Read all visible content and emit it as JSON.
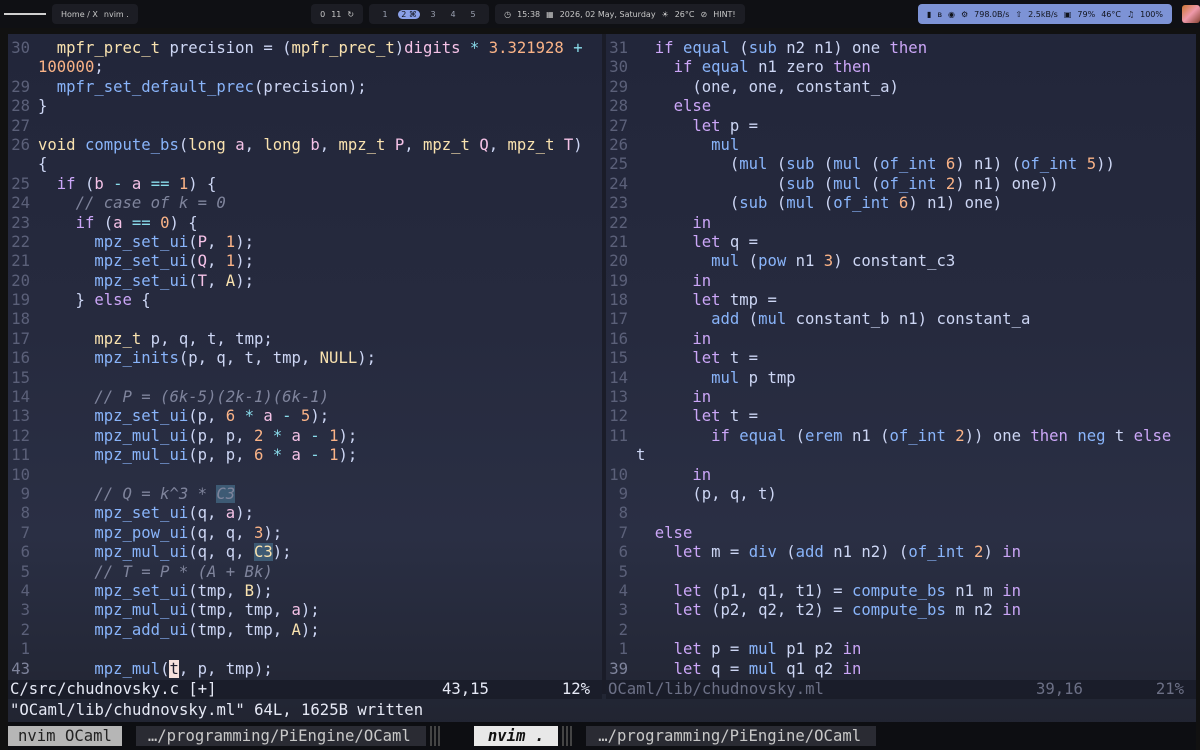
{
  "topbar": {
    "home_label": "Home / X",
    "nvim_label": "nvim .",
    "ws_icon": "0",
    "ws_count": "11",
    "workspaces": [
      "1",
      "2 ⌘",
      "3",
      "4",
      "5"
    ],
    "time": "15:38",
    "date": "2026, 02 May, Saturday",
    "temp": "26°C",
    "hint": "HINT!",
    "net_down": "798.0B/s",
    "net_up": "2.5kB/s",
    "cpu": "79%",
    "cpu_temp": "46°C",
    "volume": "100%"
  },
  "left_pane": {
    "lines": [
      {
        "n": "30",
        "html": "  <span class=\"ty\">mpfr_prec_t</span> precision = (<span class=\"ty\">mpfr_prec_t</span>)<span class=\"var\">digits</span> <span class=\"op\">*</span> <span class=\"num\">3.321928</span> <span class=\"op\">+</span>"
      },
      {
        "n": "",
        "html": "<span class=\"num\">100000</span>;"
      },
      {
        "n": "29",
        "html": "  <span class=\"fn\">mpfr_set_default_prec</span>(precision);"
      },
      {
        "n": "28",
        "html": "}"
      },
      {
        "n": "27",
        "html": ""
      },
      {
        "n": "26",
        "html": "<span class=\"ty\">void</span> <span class=\"fn\">compute_bs</span>(<span class=\"ty\">long</span> <span class=\"var\">a</span>, <span class=\"ty\">long</span> <span class=\"var\">b</span>, <span class=\"ty\">mpz_t</span> <span class=\"var\">P</span>, <span class=\"ty\">mpz_t</span> <span class=\"var\">Q</span>, <span class=\"ty\">mpz_t</span> <span class=\"var\">T</span>)"
      },
      {
        "n": "",
        "html": "{"
      },
      {
        "n": "25",
        "html": "  <span class=\"kw\">if</span> (<span class=\"var\">b</span> <span class=\"op\">-</span> <span class=\"var\">a</span> <span class=\"op\">==</span> <span class=\"num\">1</span>) {"
      },
      {
        "n": "24",
        "html": "    <span class=\"cm\">// case of k = 0</span>"
      },
      {
        "n": "23",
        "html": "    <span class=\"kw\">if</span> (<span class=\"var\">a</span> <span class=\"op\">==</span> <span class=\"num\">0</span>) {"
      },
      {
        "n": "22",
        "html": "      <span class=\"fn\">mpz_set_ui</span>(<span class=\"var\">P</span>, <span class=\"num\">1</span>);"
      },
      {
        "n": "21",
        "html": "      <span class=\"fn\">mpz_set_ui</span>(<span class=\"var\">Q</span>, <span class=\"num\">1</span>);"
      },
      {
        "n": "20",
        "html": "      <span class=\"fn\">mpz_set_ui</span>(<span class=\"var\">T</span>, <span class=\"mac\">A</span>);"
      },
      {
        "n": "19",
        "html": "    } <span class=\"kw\">else</span> {"
      },
      {
        "n": "18",
        "html": ""
      },
      {
        "n": "17",
        "html": "      <span class=\"ty\">mpz_t</span> p, q, t, tmp;"
      },
      {
        "n": "16",
        "html": "      <span class=\"fn\">mpz_inits</span>(p, q, t, tmp, <span class=\"mac\">NULL</span>);"
      },
      {
        "n": "15",
        "html": ""
      },
      {
        "n": "14",
        "html": "      <span class=\"cm\">// P = (6k-5)(2k-1)(6k-1)</span>"
      },
      {
        "n": "13",
        "html": "      <span class=\"fn\">mpz_set_ui</span>(p, <span class=\"num\">6</span> <span class=\"op\">*</span> <span class=\"var\">a</span> <span class=\"op\">-</span> <span class=\"num\">5</span>);"
      },
      {
        "n": "12",
        "html": "      <span class=\"fn\">mpz_mul_ui</span>(p, p, <span class=\"num\">2</span> <span class=\"op\">*</span> <span class=\"var\">a</span> <span class=\"op\">-</span> <span class=\"num\">1</span>);"
      },
      {
        "n": "11",
        "html": "      <span class=\"fn\">mpz_mul_ui</span>(p, p, <span class=\"num\">6</span> <span class=\"op\">*</span> <span class=\"var\">a</span> <span class=\"op\">-</span> <span class=\"num\">1</span>);"
      },
      {
        "n": "10",
        "html": ""
      },
      {
        "n": "9",
        "html": "      <span class=\"cm\">// Q = k^3 * </span><span class=\"cm hl\">C3</span>"
      },
      {
        "n": "8",
        "html": "      <span class=\"fn\">mpz_set_ui</span>(q, <span class=\"var\">a</span>);"
      },
      {
        "n": "7",
        "html": "      <span class=\"fn\">mpz_pow_ui</span>(q, q, <span class=\"num\">3</span>);"
      },
      {
        "n": "6",
        "html": "      <span class=\"fn\">mpz_mul_ui</span>(q, q, <span class=\"mac hl\">C3</span>);"
      },
      {
        "n": "5",
        "html": "      <span class=\"cm\">// T = P * (A + Bk)</span>"
      },
      {
        "n": "4",
        "html": "      <span class=\"fn\">mpz_set_ui</span>(tmp, <span class=\"mac\">B</span>);"
      },
      {
        "n": "3",
        "html": "      <span class=\"fn\">mpz_mul_ui</span>(tmp, tmp, <span class=\"var\">a</span>);"
      },
      {
        "n": "2",
        "html": "      <span class=\"fn\">mpz_add_ui</span>(tmp, tmp, <span class=\"mac\">A</span>);"
      },
      {
        "n": "1",
        "html": ""
      },
      {
        "n": "43",
        "html": "      <span class=\"fn\">mpz_mul</span>(<span class=\"cursor\">t</span>, p, tmp);",
        "current": true
      }
    ],
    "status": {
      "file": "C/src/chudnovsky.c [+]",
      "pos": "43,15",
      "pct": "12%"
    }
  },
  "right_pane": {
    "lines": [
      {
        "n": "31",
        "html": "  <span class=\"kw\">if</span> <span class=\"fn\">equal</span> (<span class=\"fn\">sub</span> n2 n1) one <span class=\"kw\">then</span>"
      },
      {
        "n": "30",
        "html": "    <span class=\"kw\">if</span> <span class=\"fn\">equal</span> n1 zero <span class=\"kw\">then</span>"
      },
      {
        "n": "29",
        "html": "      (one, one, constant_a)"
      },
      {
        "n": "28",
        "html": "    <span class=\"kw\">else</span>"
      },
      {
        "n": "27",
        "html": "      <span class=\"kw\">let</span> p ="
      },
      {
        "n": "26",
        "html": "        <span class=\"fn\">mul</span>"
      },
      {
        "n": "25",
        "html": "          (<span class=\"fn\">mul</span> (<span class=\"fn\">sub</span> (<span class=\"fn\">mul</span> (<span class=\"fn\">of_int</span> <span class=\"num\">6</span>) n1) (<span class=\"fn\">of_int</span> <span class=\"num\">5</span>))"
      },
      {
        "n": "24",
        "html": "               (<span class=\"fn\">sub</span> (<span class=\"fn\">mul</span> (<span class=\"fn\">of_int</span> <span class=\"num\">2</span>) n1) one))"
      },
      {
        "n": "23",
        "html": "          (<span class=\"fn\">sub</span> (<span class=\"fn\">mul</span> (<span class=\"fn\">of_int</span> <span class=\"num\">6</span>) n1) one)"
      },
      {
        "n": "22",
        "html": "      <span class=\"kw\">in</span>"
      },
      {
        "n": "21",
        "html": "      <span class=\"kw\">let</span> q ="
      },
      {
        "n": "20",
        "html": "        <span class=\"fn\">mul</span> (<span class=\"fn\">pow</span> n1 <span class=\"num\">3</span>) constant_c3"
      },
      {
        "n": "19",
        "html": "      <span class=\"kw\">in</span>"
      },
      {
        "n": "18",
        "html": "      <span class=\"kw\">let</span> tmp ="
      },
      {
        "n": "17",
        "html": "        <span class=\"fn\">add</span> (<span class=\"fn\">mul</span> constant_b n1) constant_a"
      },
      {
        "n": "16",
        "html": "      <span class=\"kw\">in</span>"
      },
      {
        "n": "15",
        "html": "      <span class=\"kw\">let</span> t ="
      },
      {
        "n": "14",
        "html": "        <span class=\"fn\">mul</span> p tmp"
      },
      {
        "n": "13",
        "html": "      <span class=\"kw\">in</span>"
      },
      {
        "n": "12",
        "html": "      <span class=\"kw\">let</span> t ="
      },
      {
        "n": "11",
        "html": "        <span class=\"kw\">if</span> <span class=\"fn\">equal</span> (<span class=\"fn\">erem</span> n1 (<span class=\"fn\">of_int</span> <span class=\"num\">2</span>)) one <span class=\"kw\">then</span> <span class=\"fn\">neg</span> t <span class=\"kw\">else</span>"
      },
      {
        "n": "",
        "html": "t"
      },
      {
        "n": "10",
        "html": "      <span class=\"kw\">in</span>"
      },
      {
        "n": "9",
        "html": "      (p, q, t)"
      },
      {
        "n": "8",
        "html": ""
      },
      {
        "n": "7",
        "html": "  <span class=\"kw\">else</span>"
      },
      {
        "n": "6",
        "html": "    <span class=\"kw\">let</span> m = <span class=\"fn\">div</span> (<span class=\"fn\">add</span> n1 n2) (<span class=\"fn\">of_int</span> <span class=\"num\">2</span>) <span class=\"kw\">in</span>"
      },
      {
        "n": "5",
        "html": ""
      },
      {
        "n": "4",
        "html": "    <span class=\"kw\">let</span> (p1, q1, t1) = <span class=\"fn\">compute_bs</span> n1 m <span class=\"kw\">in</span>"
      },
      {
        "n": "3",
        "html": "    <span class=\"kw\">let</span> (p2, q2, t2) = <span class=\"fn\">compute_bs</span> m n2 <span class=\"kw\">in</span>"
      },
      {
        "n": "2",
        "html": ""
      },
      {
        "n": "1",
        "html": "    <span class=\"kw\">let</span> p = <span class=\"fn\">mul</span> p1 p2 <span class=\"kw\">in</span>"
      },
      {
        "n": "39",
        "html": "    <span class=\"kw\">let</span> q = <span class=\"fn\">mul</span> q1 q2 <span class=\"kw\">in</span>",
        "current": true
      }
    ],
    "status": {
      "file": "OCaml/lib/chudnovsky.ml",
      "pos": "39,16",
      "pct": "21%"
    }
  },
  "cmdline": "\"OCaml/lib/chudnovsky.ml\" 64L, 1625B written",
  "tmux": {
    "left_label": "nvim OCaml",
    "left_path": "…/programming/PiEngine/OCaml",
    "active_label": "nvim .",
    "right_path": "…/programming/PiEngine/OCaml"
  }
}
